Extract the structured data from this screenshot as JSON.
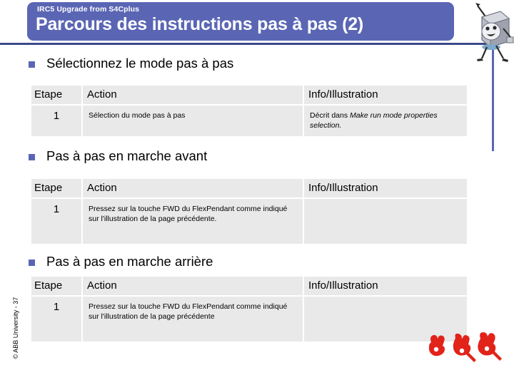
{
  "slide": {
    "eyebrow": "IRC5 Upgrade from S4Cplus",
    "title": "Parcours des instructions pas à pas (2)",
    "copyright": "© ABB University - 37",
    "colors": {
      "banner": "#5a66b4",
      "rule": "#3b4a8c",
      "table_cell": "#e9e9e9",
      "hand_red": "#e2231a"
    }
  },
  "sections": [
    {
      "bullet": "Sélectionnez le mode pas à pas",
      "table": {
        "headers": [
          "Etape",
          "Action",
          "Info/Illustration"
        ],
        "rows": [
          {
            "etape": "1",
            "action": "Sélection du mode pas à pas",
            "info_prefix": "Décrit dans ",
            "info_italic": "Make run mode properties selection.",
            "info_suffix": ""
          }
        ]
      }
    },
    {
      "bullet": "Pas à pas en marche avant",
      "table": {
        "headers": [
          "Etape",
          "Action",
          "Info/Illustration"
        ],
        "rows": [
          {
            "etape": "1",
            "action": "Pressez sur la touche FWD du FlexPendant comme indiqué sur l'illustration de la page précédente.",
            "info_prefix": "",
            "info_italic": "",
            "info_suffix": ""
          }
        ]
      }
    },
    {
      "bullet": "Pas à pas en marche arrière",
      "table": {
        "headers": [
          "Etape",
          "Action",
          "Info/Illustration"
        ],
        "rows": [
          {
            "etape": "1",
            "action": "Pressez sur la touche FWD du FlexPendant comme indiqué sur l'illustration de la page précédente",
            "info_prefix": "",
            "info_italic": "",
            "info_suffix": ""
          }
        ]
      }
    }
  ],
  "decorations": {
    "mascot": "robot-mascot-icon",
    "hands": [
      "pointing-hand-icon",
      "pointing-hand-icon",
      "pointing-hand-icon"
    ]
  }
}
